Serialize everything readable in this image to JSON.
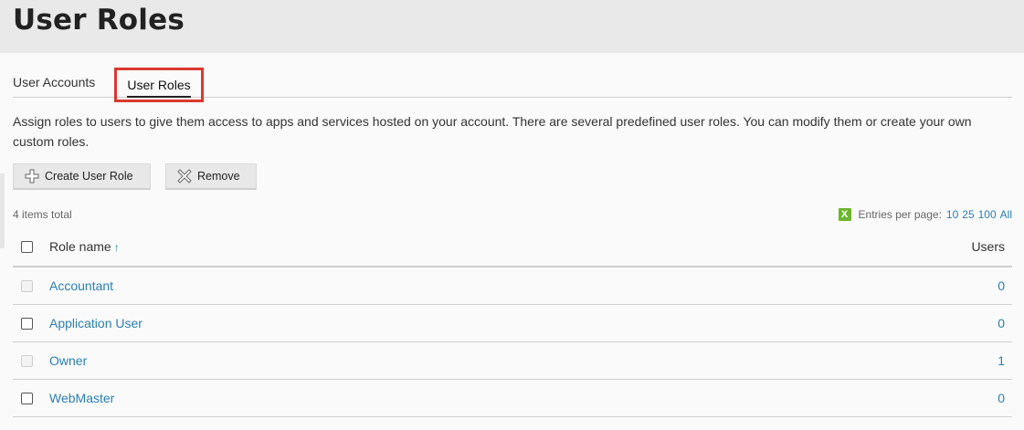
{
  "header": {
    "title": "User Roles"
  },
  "tabs": [
    {
      "label": "User Accounts"
    },
    {
      "label": "User Roles",
      "active": true
    }
  ],
  "description": "Assign roles to users to give them access to apps and services hosted on your account. There are several predefined user roles. You can modify them or create your own custom roles.",
  "toolbar": {
    "create_label": "Create User Role",
    "create_icon": "plus-icon",
    "remove_label": "Remove",
    "remove_icon": "x-icon"
  },
  "list": {
    "total_text": "4 items total",
    "entries_label": "Entries per page:",
    "entries_options": [
      "10",
      "25",
      "100",
      "All"
    ],
    "export_icon": "excel-icon"
  },
  "table": {
    "headers": {
      "name": "Role name",
      "sort_indicator": "↑",
      "users": "Users"
    },
    "rows": [
      {
        "name": "Accountant",
        "users": "0",
        "checkbox_enabled": false
      },
      {
        "name": "Application User",
        "users": "0",
        "checkbox_enabled": true
      },
      {
        "name": "Owner",
        "users": "1",
        "checkbox_enabled": false
      },
      {
        "name": "WebMaster",
        "users": "0",
        "checkbox_enabled": true
      }
    ]
  },
  "colors": {
    "accent": "#2a7fb3",
    "highlight": "#d9392f",
    "excel": "#6bb52e"
  }
}
